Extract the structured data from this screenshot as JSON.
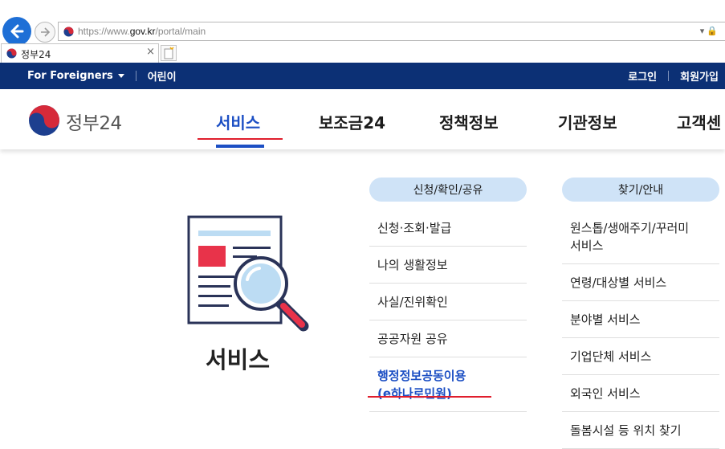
{
  "browser": {
    "url_prefix": "https://www.",
    "url_host": "gov.kr",
    "url_path": "/portal/main",
    "tab_title": "정부24",
    "tab_close": "×"
  },
  "topbar": {
    "foreigners": "For Foreigners",
    "kids": "어린이",
    "login": "로그인",
    "signup": "회원가입"
  },
  "header": {
    "logo_text": "정부24",
    "nav": [
      "서비스",
      "보조금24",
      "정책정보",
      "기관정보",
      "고객센"
    ]
  },
  "content": {
    "title": "서비스",
    "col1": {
      "heading": "신청/확인/공유",
      "items": [
        "신청·조회·발급",
        "나의 생활정보",
        "사실/진위확인",
        "공공자원 공유"
      ],
      "highlight_line1": "행정정보공동이용",
      "highlight_line2": "(e하나로민원)"
    },
    "col2": {
      "heading": "찾기/안내",
      "items": [
        "원스톱/생애주기/꾸러미",
        "서비스",
        "연령/대상별 서비스",
        "분야별 서비스",
        "기업단체 서비스",
        "외국인 서비스",
        "돌봄시설 등 위치 찾기"
      ]
    }
  },
  "colors": {
    "topbar": "#0c3075",
    "accent": "#1c4fc4",
    "pill": "#cfe3f7",
    "red": "#e01e2d"
  }
}
